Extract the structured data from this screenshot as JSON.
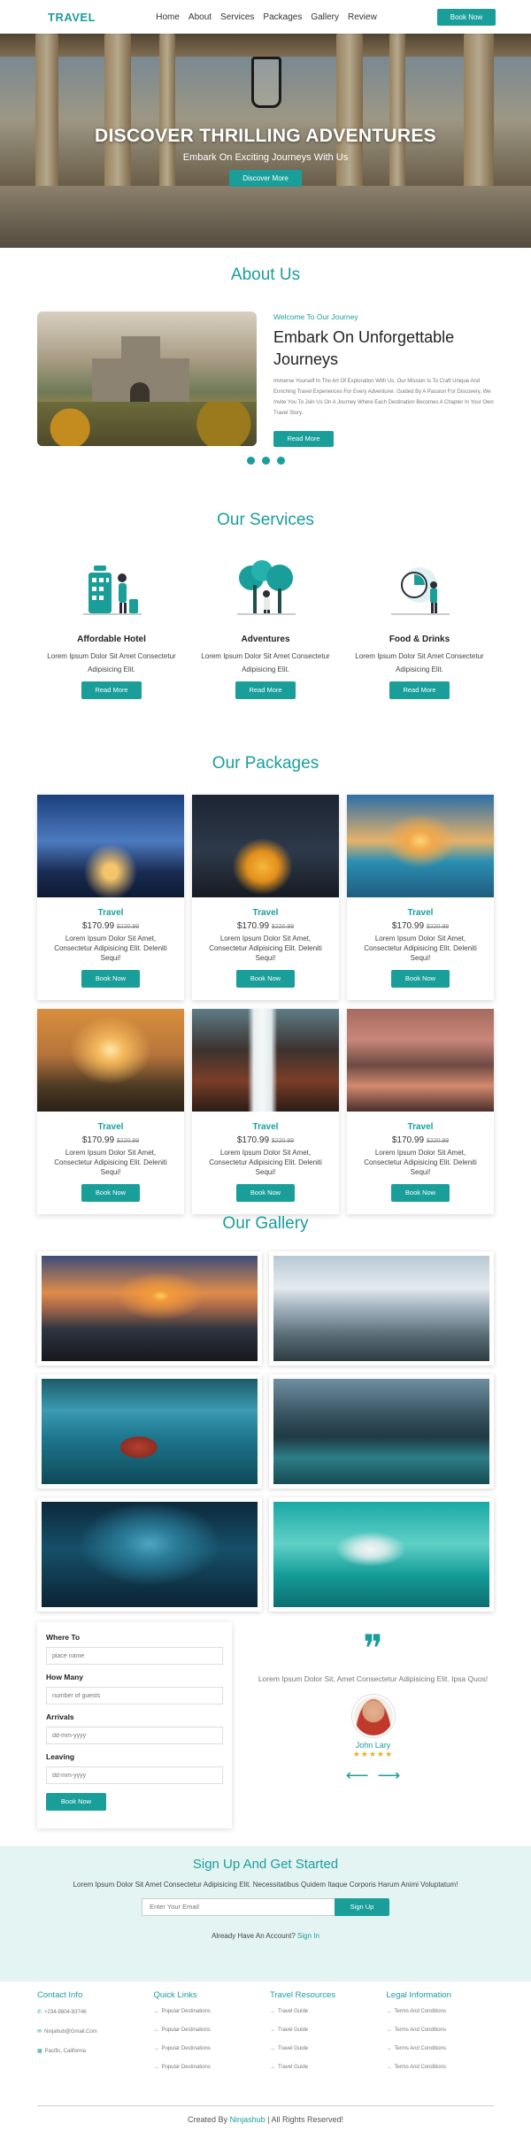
{
  "nav": {
    "logo": "TRAVEL",
    "links": [
      "Home",
      "About",
      "Services",
      "Packages",
      "Gallery",
      "Review"
    ],
    "cta": "Book Now"
  },
  "hero": {
    "title": "DISCOVER THRILLING ADVENTURES",
    "subtitle": "Embark On Exciting Journeys With Us",
    "button": "Discover More"
  },
  "about": {
    "section_title": "About Us",
    "kicker": "Welcome To Our Journey",
    "heading": "Embark On Unforgettable Journeys",
    "description": "Immerse Yourself In The Art Of Exploration With Us. Our Mission Is To Craft Unique And Enriching Travel Experiences For Every Adventurer. Guided By A Passion For Discovery, We Invite You To Join Us On A Journey Where Each Destination Becomes A Chapter In Your Own Travel Story.",
    "button": "Read More"
  },
  "services": {
    "section_title": "Our Services",
    "items": [
      {
        "title": "Affordable Hotel",
        "text": "Lorem Ipsum Dolor Sit Amet Consectetur Adipisicing Elit.",
        "button": "Read More",
        "icon": "hotel-icon"
      },
      {
        "title": "Adventures",
        "text": "Lorem Ipsum Dolor Sit Amet Consectetur Adipisicing Elit.",
        "button": "Read More",
        "icon": "adventure-icon"
      },
      {
        "title": "Food & Drinks",
        "text": "Lorem Ipsum Dolor Sit Amet Consectetur Adipisicing Elit.",
        "button": "Read More",
        "icon": "food-icon"
      }
    ]
  },
  "packages": {
    "section_title": "Our Packages",
    "items": [
      {
        "name": "Travel",
        "price": "$170.99",
        "old": "$220.99",
        "text": "Lorem Ipsum Dolor Sit Amet, Consectetur Adipisicing Elit. Deleniti Sequi!",
        "button": "Book Now"
      },
      {
        "name": "Travel",
        "price": "$170.99",
        "old": "$220.99",
        "text": "Lorem Ipsum Dolor Sit Amet, Consectetur Adipisicing Elit. Deleniti Sequi!",
        "button": "Book Now"
      },
      {
        "name": "Travel",
        "price": "$170.99",
        "old": "$220.99",
        "text": "Lorem Ipsum Dolor Sit Amet, Consectetur Adipisicing Elit. Deleniti Sequi!",
        "button": "Book Now"
      },
      {
        "name": "Travel",
        "price": "$170.99",
        "old": "$220.99",
        "text": "Lorem Ipsum Dolor Sit Amet, Consectetur Adipisicing Elit. Deleniti Sequi!",
        "button": "Book Now"
      },
      {
        "name": "Travel",
        "price": "$170.99",
        "old": "$220.99",
        "text": "Lorem Ipsum Dolor Sit Amet, Consectetur Adipisicing Elit. Deleniti Sequi!",
        "button": "Book Now"
      },
      {
        "name": "Travel",
        "price": "$170.99",
        "old": "$220.99",
        "text": "Lorem Ipsum Dolor Sit Amet, Consectetur Adipisicing Elit. Deleniti Sequi!",
        "button": "Book Now"
      }
    ]
  },
  "gallery": {
    "section_title": "Our Gallery"
  },
  "booking": {
    "where_label": "Where To",
    "where_placeholder": "place name",
    "how_label": "How Many",
    "how_placeholder": "number of guests",
    "arrivals_label": "Arrivals",
    "arrivals_placeholder": "dd-mm-yyyy",
    "leaving_label": "Leaving",
    "leaving_placeholder": "dd-mm-yyyy",
    "button": "Book Now"
  },
  "review": {
    "quote_mark": "❞",
    "text": "Lorem Ipsum Dolor Sit, Amet Consectetur Adipisicing Elit. Ipsa Quos!",
    "name": "John Lary",
    "stars": "★★★★★"
  },
  "signup": {
    "title": "Sign Up And Get Started",
    "text": "Lorem Ipsum Dolor Sit Amet Consectetur Adipisicing Elit. Necessitatibus Quidem Itaque Corporis Harum Animi Voluptatum!",
    "placeholder": "Enter Your Email",
    "button": "Sign Up",
    "already": "Already Have An Account?",
    "signin": "Sign In"
  },
  "footer": {
    "contact": {
      "title": "Contact Info",
      "items": [
        "+234-9804-83746",
        "Ninjahub@Gmail.Com",
        "Pacific, California"
      ]
    },
    "quick": {
      "title": "Quick Links",
      "items": [
        "Popular Destinations",
        "Popular Destinations",
        "Popular Destinations",
        "Popular Destinations"
      ]
    },
    "resources": {
      "title": "Travel Resources",
      "items": [
        "Travel Guide",
        "Travel Guide",
        "Travel Guide",
        "Travel Guide"
      ]
    },
    "legal": {
      "title": "Legal Information",
      "items": [
        "Terms And Conditions",
        "Terms And Conditions",
        "Terms And Conditions",
        "Terms And Conditions"
      ]
    },
    "copy_prefix": "Created By",
    "copy_brand": "Ninjashub",
    "copy_suffix": "| All Rights Reserved!"
  },
  "colors": {
    "accent": "#1a9e9a"
  }
}
